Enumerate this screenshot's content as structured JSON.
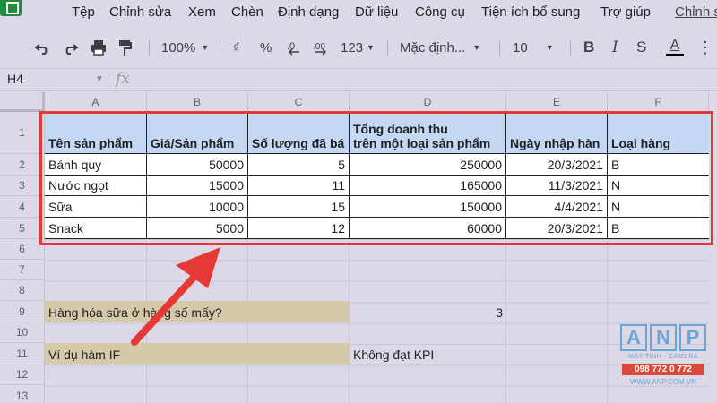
{
  "menu": {
    "items": [
      "Tệp",
      "Chỉnh sửa",
      "Xem",
      "Chèn",
      "Định dạng",
      "Dữ liệu",
      "Công cụ",
      "Tiện ích bổ sung",
      "Trợ giúp"
    ],
    "last_edit_link": "Chỉnh s"
  },
  "toolbar": {
    "zoom": "100%",
    "currency": "₫",
    "percent": "%",
    "decimal_dec": ".0",
    "decimal_inc": ".00",
    "number_format": "123",
    "font": "Mặc định...",
    "font_size": "10",
    "text_color_letter": "A"
  },
  "formula_bar": {
    "name_box": "H4",
    "fx_label": "fx"
  },
  "columns": [
    "A",
    "B",
    "C",
    "D",
    "E",
    "F"
  ],
  "rows": [
    "1",
    "2",
    "3",
    "4",
    "5",
    "6",
    "7",
    "8",
    "9",
    "10",
    "11",
    "12",
    "13"
  ],
  "table": {
    "headers": [
      "Tên sản phẩm",
      "Giá/Sản phẩm",
      "Số lượng đã bá",
      "Tổng doanh thu",
      "trên một loại sản phẩm",
      "Ngày nhập hàn",
      "Loại hàng"
    ],
    "rows": [
      [
        "Bánh quy",
        "50000",
        "5",
        "250000",
        "20/3/2021",
        "B"
      ],
      [
        "Nước ngọt",
        "15000",
        "11",
        "165000",
        "11/3/2021",
        "N"
      ],
      [
        "Sữa",
        "10000",
        "15",
        "150000",
        "4/4/2021",
        "N"
      ],
      [
        "Snack",
        "5000",
        "12",
        "60000",
        "20/3/2021",
        "B"
      ]
    ]
  },
  "extra": {
    "question": "Hàng hóa sữa ở hàng số mấy?",
    "answer": "3",
    "example_label": "Ví dụ hàm IF",
    "example_result": "Không đạt KPI"
  },
  "watermark": {
    "letters": [
      "A",
      "N",
      "P"
    ],
    "subtitle": "MÁY TÍNH - CAMERA",
    "phone": "098 772 0 772",
    "url": "WWW.ANP.COM.VN"
  },
  "colors": {
    "header_fill": "#c5d8f3",
    "highlight_border": "#e53935",
    "arrow": "#e53935",
    "tan_fill": "#d4c9a8"
  }
}
